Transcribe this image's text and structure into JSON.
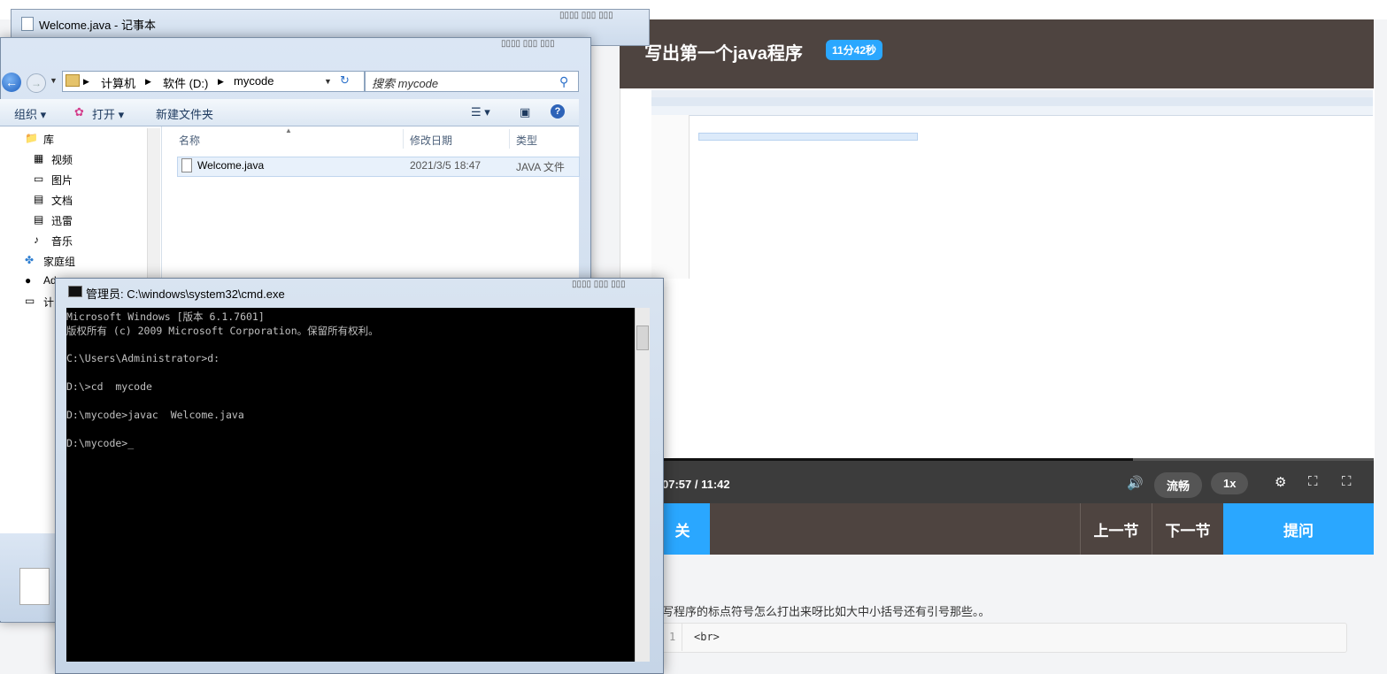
{
  "web": {
    "video_title": "写出第一个java程序",
    "duration_badge": "11分42秒",
    "time_display": "07:57 / 11:42",
    "quality_label": "流畅",
    "speed_label": "1x",
    "nav_related": "关",
    "nav_prev": "上一节",
    "nav_next": "下一节",
    "ask_button": "提问",
    "question_text": "问写程序的标点符号怎么打出来呀比如大中小括号还有引号那些。。",
    "code_line_number": "1",
    "code_text": "<br>",
    "accent_color": "#2aa7ff"
  },
  "notepad": {
    "title": "Welcome.java - 记事本"
  },
  "explorer": {
    "breadcrumb": [
      "计算机",
      "软件 (D:)",
      "mycode"
    ],
    "search_placeholder": "搜索 mycode",
    "toolbar": {
      "organize": "组织",
      "open": "打开",
      "new_folder": "新建文件夹"
    },
    "nav_items": [
      "库",
      "视频",
      "图片",
      "文档",
      "迅雷",
      "音乐",
      "家庭组",
      "Ad",
      "计"
    ],
    "columns": [
      "名称",
      "修改日期",
      "类型"
    ],
    "files": [
      {
        "name": "Welcome.java",
        "modified": "2021/3/5 18:47",
        "type": "JAVA 文件"
      }
    ]
  },
  "cmd": {
    "title": "管理员: C:\\windows\\system32\\cmd.exe",
    "lines": [
      "Microsoft Windows [版本 6.1.7601]",
      "版权所有 (c) 2009 Microsoft Corporation。保留所有权利。",
      "",
      "C:\\Users\\Administrator>d:",
      "",
      "D:\\>cd  mycode",
      "",
      "D:\\mycode>javac  Welcome.java",
      "",
      "D:\\mycode>_"
    ]
  }
}
